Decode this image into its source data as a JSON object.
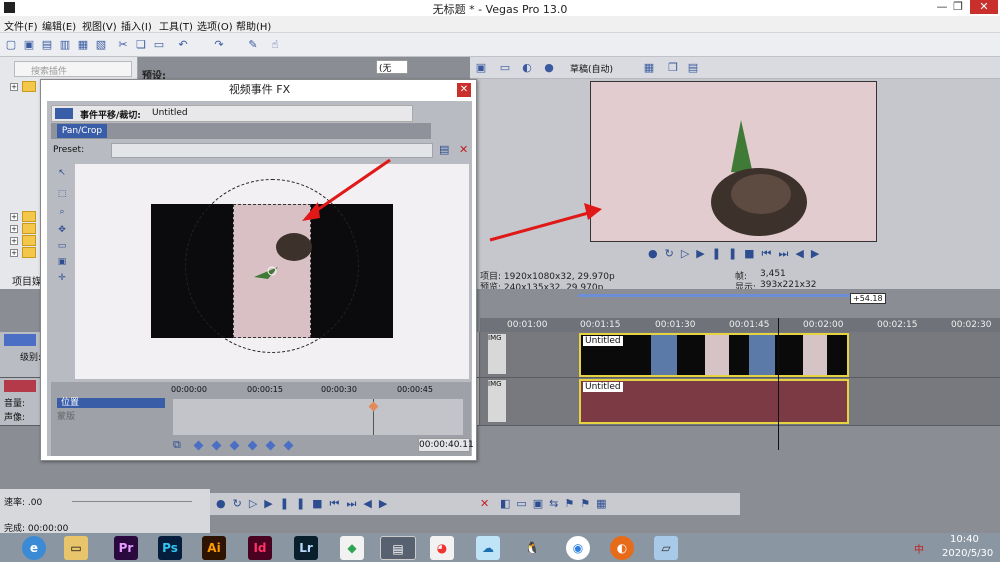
{
  "window": {
    "title": "无标题 * - Vegas Pro 13.0"
  },
  "menu": [
    "文件(F)",
    "编辑(E)",
    "视图(V)",
    "插入(I)",
    "工具(T)",
    "选项(O)",
    "帮助(H)"
  ],
  "explorer": {
    "search_placeholder": "搜索插件",
    "preset_label": "预设:",
    "tab_label": "项目媒"
  },
  "preview": {
    "quality": "草稿(自动)",
    "project_line": "项目: 1920x1080x32, 29.970p",
    "preview_line": "预览: 240x135x32, 29.970p",
    "frame_label": "帧:",
    "frame_value": "3,451",
    "display_label": "显示:",
    "display_value": "393x221x32",
    "dropdown_value": "(无"
  },
  "dialog": {
    "title": "视频事件 FX",
    "header_label": "事件平移/裁切:",
    "header_name": "Untitled",
    "chain_item": "Pan/Crop",
    "preset_label": "Preset:",
    "keyframe_times": [
      "00:00:00",
      "00:00:15",
      "00:00:30",
      "00:00:45"
    ],
    "keyframe_row_label": "位置",
    "keyframe_row_sub": "蒙版",
    "current_time": "00:00:40.11"
  },
  "timeline": {
    "time_markers": [
      "00:01:00",
      "00:01:15",
      "00:01:30",
      "00:01:45",
      "00:02:00",
      "00:02:15",
      "00:02:30"
    ],
    "cursor_offset": "+54.18",
    "track1_label": "级别:",
    "track2_volume": "音量:",
    "track2_pan": "声像:",
    "video_clip_title": "Untitled",
    "audio_clip_title": "Untitled",
    "small_clip_label": "IMG"
  },
  "status": {
    "rate": "速率: .00",
    "complete": "完成: 00:00:00"
  },
  "taskbar": {
    "apps": [
      "Pr",
      "Ps",
      "Ai",
      "Id",
      "Lr"
    ],
    "time": "10:40",
    "date": "2020/5/30",
    "ime": "中"
  },
  "colors": {
    "accent": "#3a5da8",
    "clip_border": "#e5d342",
    "audio_clip": "#7c3a45",
    "annotation_arrow": "#e01818"
  }
}
